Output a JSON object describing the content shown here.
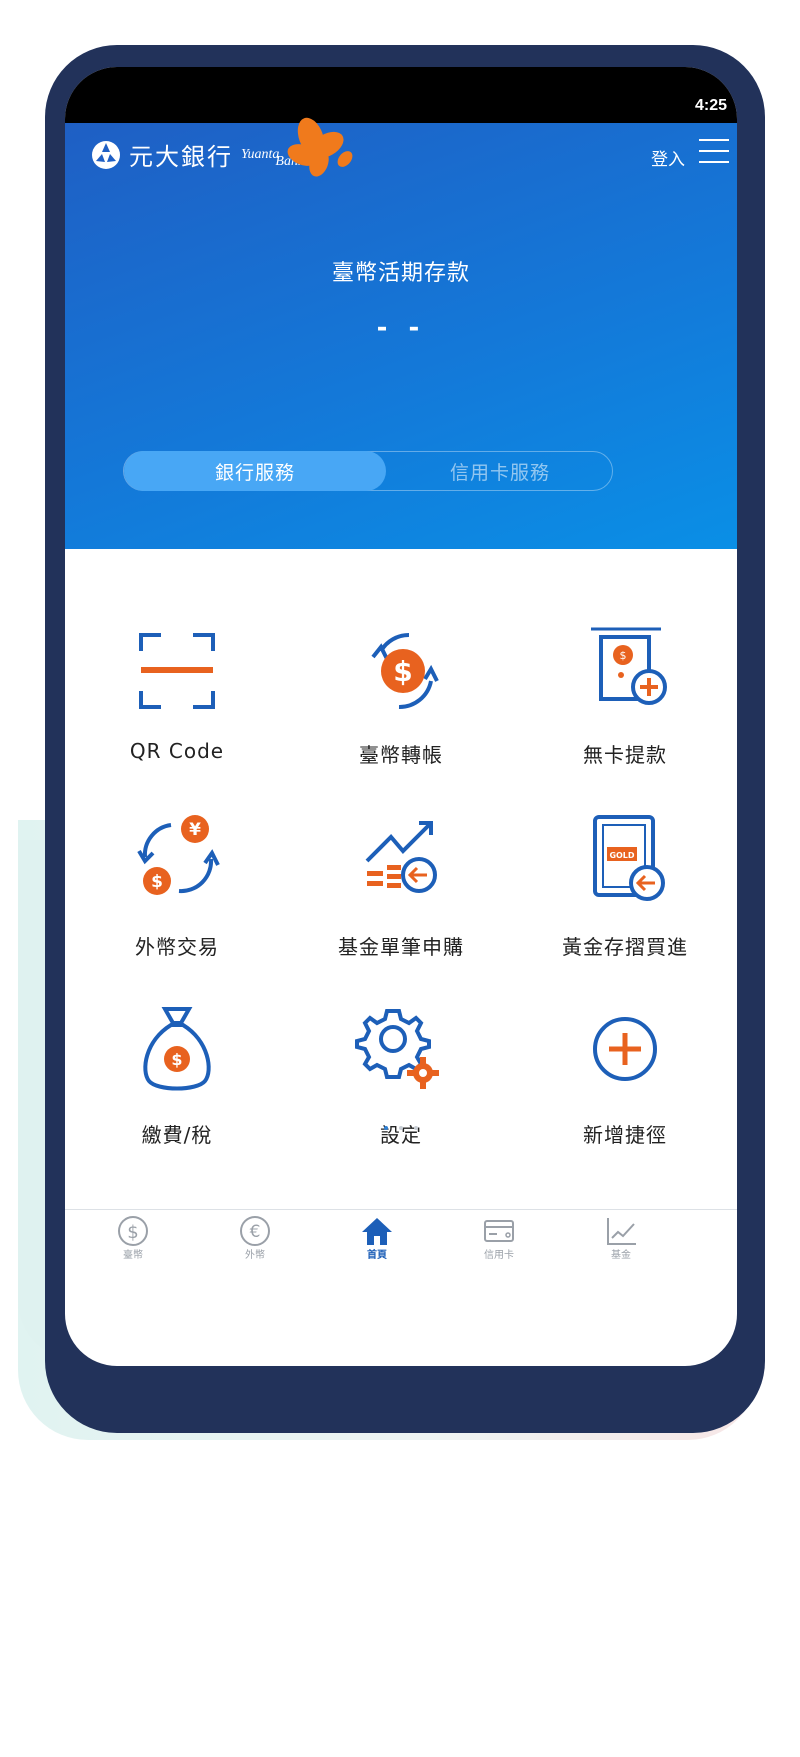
{
  "status": {
    "time": "4:25"
  },
  "brand": {
    "name": "元大銀行",
    "en_name": "Yuanta",
    "en_sub": "Bank"
  },
  "header": {
    "login": "登入",
    "account_title": "臺幣活期存款",
    "balance": "- -"
  },
  "segment": {
    "active": "銀行服務",
    "inactive": "信用卡服務"
  },
  "features": [
    {
      "label": "QR Code",
      "icon": "qr-scan-icon"
    },
    {
      "label": "臺幣轉帳",
      "icon": "ntd-transfer-icon"
    },
    {
      "label": "無卡提款",
      "icon": "cardless-withdrawal-icon"
    },
    {
      "label": "外幣交易",
      "icon": "fx-exchange-icon"
    },
    {
      "label": "基金單筆申購",
      "icon": "fund-purchase-icon"
    },
    {
      "label": "黃金存摺買進",
      "icon": "gold-passbook-icon"
    },
    {
      "label": "繳費/稅",
      "icon": "money-bag-icon"
    },
    {
      "label": "設定",
      "icon": "settings-gear-icon"
    },
    {
      "label": "新增捷徑",
      "icon": "add-shortcut-icon"
    }
  ],
  "pager": {
    "pages": 3,
    "current": 1
  },
  "tabbar": [
    {
      "label": "臺幣",
      "icon": "dollar-coin-icon"
    },
    {
      "label": "外幣",
      "icon": "euro-coin-icon"
    },
    {
      "label": "首頁",
      "icon": "home-icon",
      "active": true
    },
    {
      "label": "信用卡",
      "icon": "credit-card-icon"
    },
    {
      "label": "基金",
      "icon": "chart-icon"
    }
  ],
  "colors": {
    "accent_orange": "#e8621f",
    "brand_blue": "#1f5fc4",
    "icon_blue": "#1d5fb8",
    "frame": "#22325a"
  }
}
